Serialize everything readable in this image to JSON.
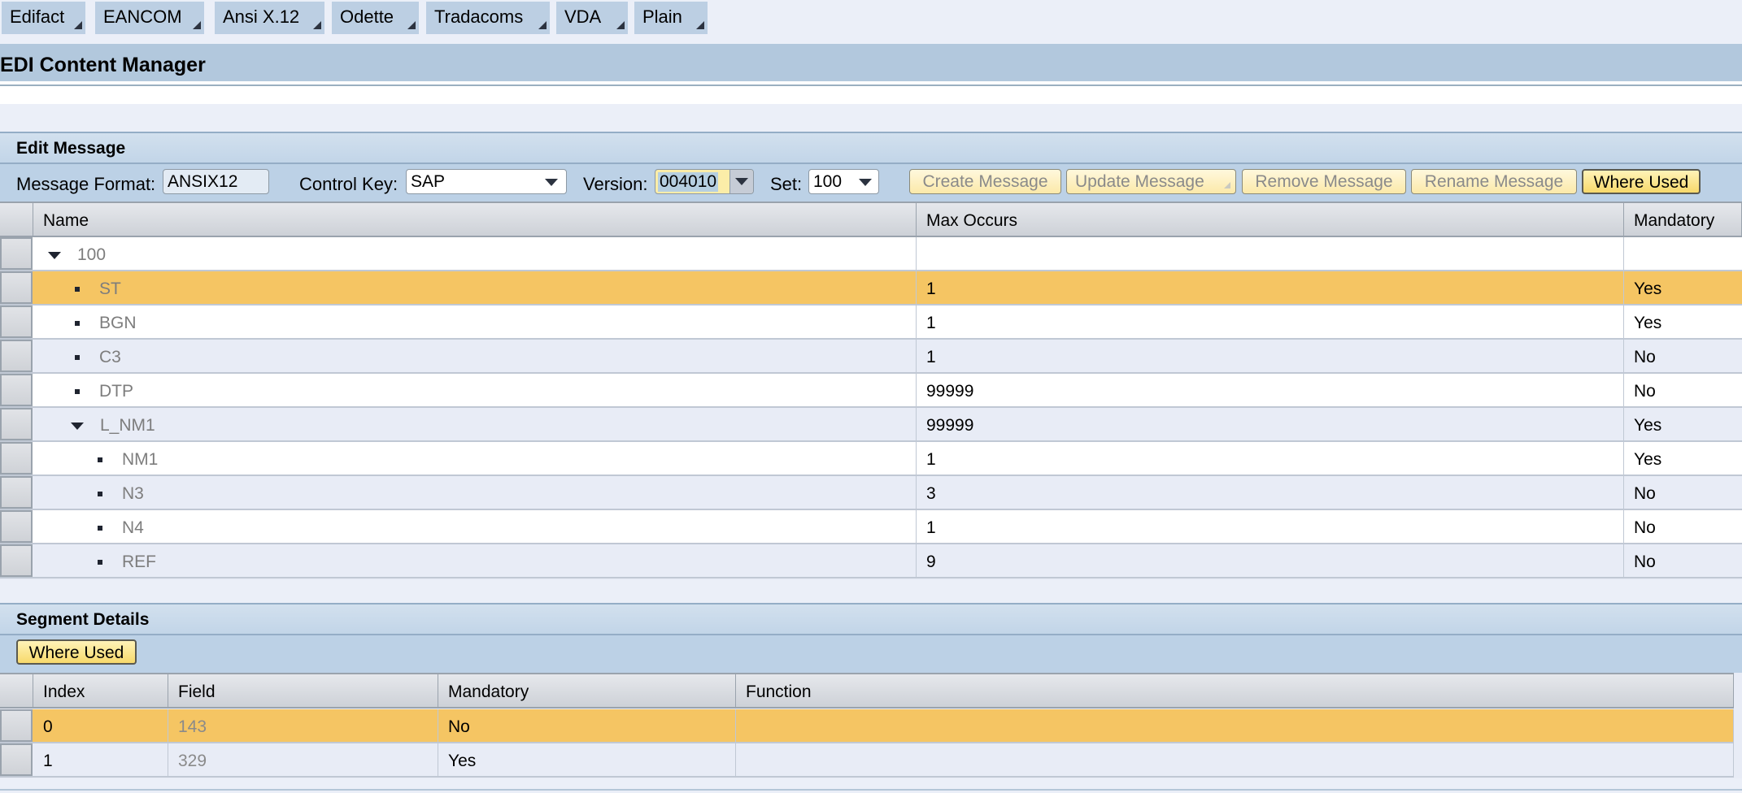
{
  "menu": {
    "tabs": [
      {
        "label": "Edifact"
      },
      {
        "label": "EANCOM"
      },
      {
        "label": "Ansi X.12"
      },
      {
        "label": "Odette"
      },
      {
        "label": "Tradacoms"
      },
      {
        "label": "VDA"
      },
      {
        "label": "Plain"
      }
    ]
  },
  "app": {
    "title": "EDI Content Manager"
  },
  "edit_message": {
    "title": "Edit Message",
    "message_format_label": "Message Format:",
    "message_format_value": "ANSIX12",
    "control_key_label": "Control Key:",
    "control_key_value": "SAP",
    "version_label": "Version:",
    "version_value": "004010",
    "set_label": "Set:",
    "set_value": "100",
    "buttons": {
      "create": "Create Message",
      "update": "Update Message",
      "remove": "Remove Message",
      "rename": "Rename Message",
      "where_used": "Where Used"
    },
    "table": {
      "columns": [
        "Name",
        "Max Occurs",
        "Mandatory"
      ],
      "rows": [
        {
          "name": "100",
          "max_occurs": "",
          "mandatory": "",
          "level": 0,
          "type": "group-expanded"
        },
        {
          "name": "ST",
          "max_occurs": "1",
          "mandatory": "Yes",
          "level": 1,
          "type": "leaf",
          "selected": true
        },
        {
          "name": "BGN",
          "max_occurs": "1",
          "mandatory": "Yes",
          "level": 1,
          "type": "leaf"
        },
        {
          "name": "C3",
          "max_occurs": "1",
          "mandatory": "No",
          "level": 1,
          "type": "leaf"
        },
        {
          "name": "DTP",
          "max_occurs": "99999",
          "mandatory": "No",
          "level": 1,
          "type": "leaf"
        },
        {
          "name": "L_NM1",
          "max_occurs": "99999",
          "mandatory": "Yes",
          "level": 1,
          "type": "group-expanded"
        },
        {
          "name": "NM1",
          "max_occurs": "1",
          "mandatory": "Yes",
          "level": 2,
          "type": "leaf"
        },
        {
          "name": "N3",
          "max_occurs": "3",
          "mandatory": "No",
          "level": 2,
          "type": "leaf"
        },
        {
          "name": "N4",
          "max_occurs": "1",
          "mandatory": "No",
          "level": 2,
          "type": "leaf"
        },
        {
          "name": "REF",
          "max_occurs": "9",
          "mandatory": "No",
          "level": 2,
          "type": "leaf"
        }
      ]
    }
  },
  "segment_details": {
    "title": "Segment Details",
    "where_used": "Where Used",
    "table": {
      "columns": [
        "Index",
        "Field",
        "Mandatory",
        "Function"
      ],
      "rows": [
        {
          "index": "0",
          "field": "143",
          "mandatory": "No",
          "function": "",
          "selected": true
        },
        {
          "index": "1",
          "field": "329",
          "mandatory": "Yes",
          "function": ""
        }
      ]
    }
  },
  "colors": {
    "header_bg": "#b2c8dd",
    "selected_row": "#f5c563",
    "button_active": "#f7d96b"
  }
}
